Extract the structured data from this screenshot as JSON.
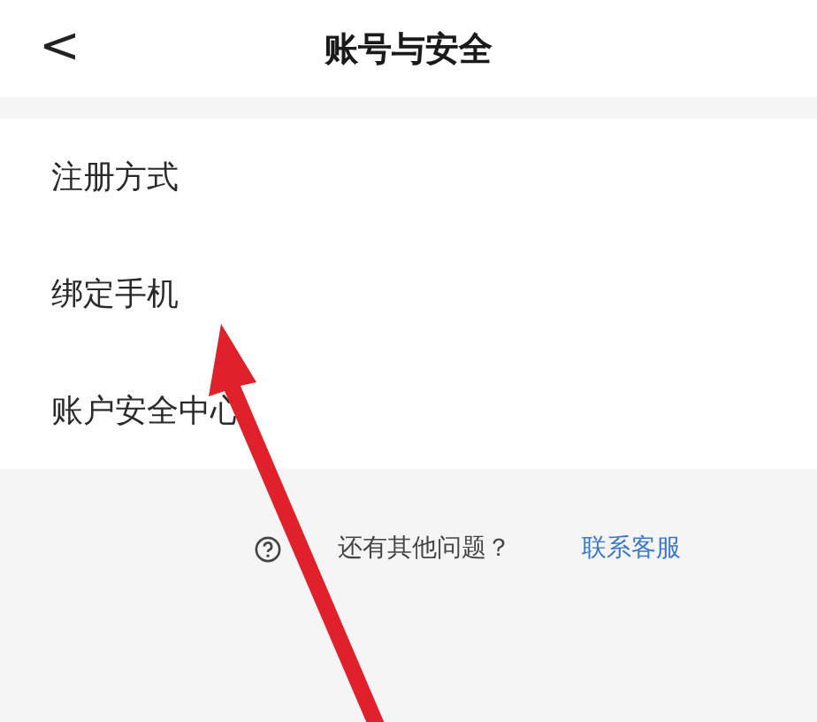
{
  "header": {
    "back": "<",
    "title": "账号与安全"
  },
  "items": [
    {
      "label": "注册方式"
    },
    {
      "label": "绑定手机"
    },
    {
      "label": "账户安全中心"
    }
  ],
  "footer": {
    "text": "还有其他问题？",
    "link": "联系客服"
  }
}
